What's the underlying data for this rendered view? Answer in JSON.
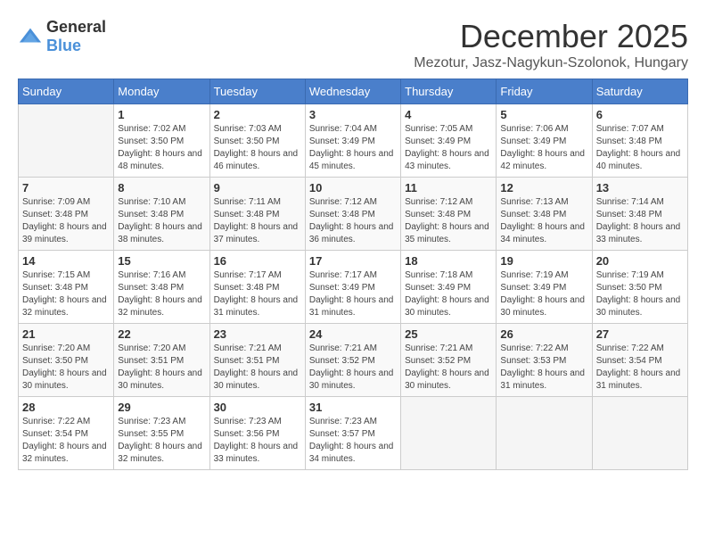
{
  "logo": {
    "general": "General",
    "blue": "Blue"
  },
  "title": {
    "month": "December 2025",
    "location": "Mezotur, Jasz-Nagykun-Szolonok, Hungary"
  },
  "headers": [
    "Sunday",
    "Monday",
    "Tuesday",
    "Wednesday",
    "Thursday",
    "Friday",
    "Saturday"
  ],
  "weeks": [
    [
      {
        "day": "",
        "sunrise": "",
        "sunset": "",
        "daylight": ""
      },
      {
        "day": "1",
        "sunrise": "Sunrise: 7:02 AM",
        "sunset": "Sunset: 3:50 PM",
        "daylight": "Daylight: 8 hours and 48 minutes."
      },
      {
        "day": "2",
        "sunrise": "Sunrise: 7:03 AM",
        "sunset": "Sunset: 3:50 PM",
        "daylight": "Daylight: 8 hours and 46 minutes."
      },
      {
        "day": "3",
        "sunrise": "Sunrise: 7:04 AM",
        "sunset": "Sunset: 3:49 PM",
        "daylight": "Daylight: 8 hours and 45 minutes."
      },
      {
        "day": "4",
        "sunrise": "Sunrise: 7:05 AM",
        "sunset": "Sunset: 3:49 PM",
        "daylight": "Daylight: 8 hours and 43 minutes."
      },
      {
        "day": "5",
        "sunrise": "Sunrise: 7:06 AM",
        "sunset": "Sunset: 3:49 PM",
        "daylight": "Daylight: 8 hours and 42 minutes."
      },
      {
        "day": "6",
        "sunrise": "Sunrise: 7:07 AM",
        "sunset": "Sunset: 3:48 PM",
        "daylight": "Daylight: 8 hours and 40 minutes."
      }
    ],
    [
      {
        "day": "7",
        "sunrise": "Sunrise: 7:09 AM",
        "sunset": "Sunset: 3:48 PM",
        "daylight": "Daylight: 8 hours and 39 minutes."
      },
      {
        "day": "8",
        "sunrise": "Sunrise: 7:10 AM",
        "sunset": "Sunset: 3:48 PM",
        "daylight": "Daylight: 8 hours and 38 minutes."
      },
      {
        "day": "9",
        "sunrise": "Sunrise: 7:11 AM",
        "sunset": "Sunset: 3:48 PM",
        "daylight": "Daylight: 8 hours and 37 minutes."
      },
      {
        "day": "10",
        "sunrise": "Sunrise: 7:12 AM",
        "sunset": "Sunset: 3:48 PM",
        "daylight": "Daylight: 8 hours and 36 minutes."
      },
      {
        "day": "11",
        "sunrise": "Sunrise: 7:12 AM",
        "sunset": "Sunset: 3:48 PM",
        "daylight": "Daylight: 8 hours and 35 minutes."
      },
      {
        "day": "12",
        "sunrise": "Sunrise: 7:13 AM",
        "sunset": "Sunset: 3:48 PM",
        "daylight": "Daylight: 8 hours and 34 minutes."
      },
      {
        "day": "13",
        "sunrise": "Sunrise: 7:14 AM",
        "sunset": "Sunset: 3:48 PM",
        "daylight": "Daylight: 8 hours and 33 minutes."
      }
    ],
    [
      {
        "day": "14",
        "sunrise": "Sunrise: 7:15 AM",
        "sunset": "Sunset: 3:48 PM",
        "daylight": "Daylight: 8 hours and 32 minutes."
      },
      {
        "day": "15",
        "sunrise": "Sunrise: 7:16 AM",
        "sunset": "Sunset: 3:48 PM",
        "daylight": "Daylight: 8 hours and 32 minutes."
      },
      {
        "day": "16",
        "sunrise": "Sunrise: 7:17 AM",
        "sunset": "Sunset: 3:48 PM",
        "daylight": "Daylight: 8 hours and 31 minutes."
      },
      {
        "day": "17",
        "sunrise": "Sunrise: 7:17 AM",
        "sunset": "Sunset: 3:49 PM",
        "daylight": "Daylight: 8 hours and 31 minutes."
      },
      {
        "day": "18",
        "sunrise": "Sunrise: 7:18 AM",
        "sunset": "Sunset: 3:49 PM",
        "daylight": "Daylight: 8 hours and 30 minutes."
      },
      {
        "day": "19",
        "sunrise": "Sunrise: 7:19 AM",
        "sunset": "Sunset: 3:49 PM",
        "daylight": "Daylight: 8 hours and 30 minutes."
      },
      {
        "day": "20",
        "sunrise": "Sunrise: 7:19 AM",
        "sunset": "Sunset: 3:50 PM",
        "daylight": "Daylight: 8 hours and 30 minutes."
      }
    ],
    [
      {
        "day": "21",
        "sunrise": "Sunrise: 7:20 AM",
        "sunset": "Sunset: 3:50 PM",
        "daylight": "Daylight: 8 hours and 30 minutes."
      },
      {
        "day": "22",
        "sunrise": "Sunrise: 7:20 AM",
        "sunset": "Sunset: 3:51 PM",
        "daylight": "Daylight: 8 hours and 30 minutes."
      },
      {
        "day": "23",
        "sunrise": "Sunrise: 7:21 AM",
        "sunset": "Sunset: 3:51 PM",
        "daylight": "Daylight: 8 hours and 30 minutes."
      },
      {
        "day": "24",
        "sunrise": "Sunrise: 7:21 AM",
        "sunset": "Sunset: 3:52 PM",
        "daylight": "Daylight: 8 hours and 30 minutes."
      },
      {
        "day": "25",
        "sunrise": "Sunrise: 7:21 AM",
        "sunset": "Sunset: 3:52 PM",
        "daylight": "Daylight: 8 hours and 30 minutes."
      },
      {
        "day": "26",
        "sunrise": "Sunrise: 7:22 AM",
        "sunset": "Sunset: 3:53 PM",
        "daylight": "Daylight: 8 hours and 31 minutes."
      },
      {
        "day": "27",
        "sunrise": "Sunrise: 7:22 AM",
        "sunset": "Sunset: 3:54 PM",
        "daylight": "Daylight: 8 hours and 31 minutes."
      }
    ],
    [
      {
        "day": "28",
        "sunrise": "Sunrise: 7:22 AM",
        "sunset": "Sunset: 3:54 PM",
        "daylight": "Daylight: 8 hours and 32 minutes."
      },
      {
        "day": "29",
        "sunrise": "Sunrise: 7:23 AM",
        "sunset": "Sunset: 3:55 PM",
        "daylight": "Daylight: 8 hours and 32 minutes."
      },
      {
        "day": "30",
        "sunrise": "Sunrise: 7:23 AM",
        "sunset": "Sunset: 3:56 PM",
        "daylight": "Daylight: 8 hours and 33 minutes."
      },
      {
        "day": "31",
        "sunrise": "Sunrise: 7:23 AM",
        "sunset": "Sunset: 3:57 PM",
        "daylight": "Daylight: 8 hours and 34 minutes."
      },
      {
        "day": "",
        "sunrise": "",
        "sunset": "",
        "daylight": ""
      },
      {
        "day": "",
        "sunrise": "",
        "sunset": "",
        "daylight": ""
      },
      {
        "day": "",
        "sunrise": "",
        "sunset": "",
        "daylight": ""
      }
    ]
  ]
}
